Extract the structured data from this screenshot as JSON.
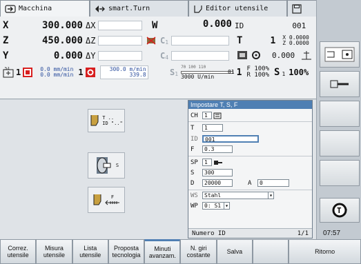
{
  "tabs": [
    {
      "label": "Macchina",
      "icon": "arrow-right-icon",
      "active": true
    },
    {
      "label": "smart.Turn",
      "icon": "diamond-arrow-icon",
      "active": false
    },
    {
      "label": "Editor utensile",
      "icon": "tool-icon",
      "active": false
    },
    {
      "label": "",
      "icon": "save-icon",
      "active": false
    }
  ],
  "status": {
    "x_label": "X",
    "x_value": "300.000",
    "dx_label": "ΔX",
    "w_label": "W",
    "w_value": "0.000",
    "id_label": "ID",
    "id_value": "001",
    "z_label": "Z",
    "z_value": "450.000",
    "dz_label": "ΔZ",
    "c1_label": "C",
    "c1_sub": "1",
    "t_label": "T",
    "t_value": "1",
    "tx_label": "X",
    "tx_value": "0.0000",
    "tz_label": "Z",
    "tz_value": "0.0000",
    "y_label": "Y",
    "y_value": "0.000",
    "dy_label": "ΔY",
    "c4_label": "C",
    "c4_sub": "4",
    "rad_value": "0.000",
    "spindle_label": "S1",
    "spindle_num": "1",
    "feed1": "0.0 mm/min",
    "feed2": "0.0 mm/min",
    "one_label": "1",
    "feed3": "300.0 m/min",
    "feed4": "339.8",
    "s1_label": "S",
    "s1_sub": "1",
    "scale": "70   100   110",
    "speed": "3000 U/min",
    "gear_label": "01",
    "gear_value": "1",
    "f_label": "F",
    "f_pct": "100%",
    "r_label": "R",
    "r_pct": "100%",
    "s_label": "S",
    "s_sub": "1",
    "s_pct": "100%"
  },
  "cycles": [
    {
      "line1": "T ..",
      "line2": "ID \"..\""
    },
    {
      "line1": "S",
      "line2": ""
    },
    {
      "line1": "F",
      "line2": ""
    }
  ],
  "dialog": {
    "title": "Impostare T, S, F",
    "ch_label": "CH",
    "ch_value": "1",
    "t_label": "T",
    "t_value": "1",
    "id_label": "ID",
    "id_value": "001",
    "f_label": "F",
    "f_value": "0.3",
    "sp_label": "SP",
    "sp_value": "1",
    "s_label": "S",
    "s_value": "300",
    "d_label": "D",
    "d_value": "20000",
    "a_label": "A",
    "a_value": "0",
    "ws_label": "WS",
    "ws_value": "Stahl",
    "wp_label": "WP",
    "wp_value": "0: S1",
    "footer_label": "Numero ID",
    "footer_page": "1/1"
  },
  "time": "07:57",
  "softkeys": [
    {
      "l1": "Correz.",
      "l2": "utensile"
    },
    {
      "l1": "Misura",
      "l2": "utensile"
    },
    {
      "l1": "Lista",
      "l2": "utensile"
    },
    {
      "l1": "Proposta",
      "l2": "tecnologia"
    },
    {
      "l1": "Minuti",
      "l2": "avanzam."
    },
    {
      "l1": "N. giri",
      "l2": "costante"
    },
    {
      "l1": "Salva",
      "l2": ""
    },
    {
      "l1": "",
      "l2": ""
    },
    {
      "l1": "Ritorno",
      "l2": ""
    }
  ],
  "colors": {
    "accent": "#4f7fb3",
    "alert": "#d81f1f"
  }
}
